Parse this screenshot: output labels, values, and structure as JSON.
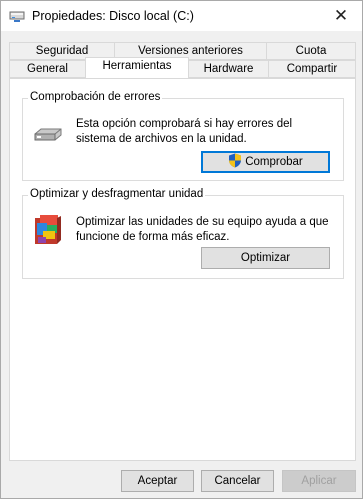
{
  "window": {
    "title": "Propiedades: Disco local (C:)",
    "close_glyph": "✕"
  },
  "tabs": {
    "row1": [
      "Seguridad",
      "Versiones anteriores",
      "Cuota"
    ],
    "row2": [
      "General",
      "Herramientas",
      "Hardware",
      "Compartir"
    ],
    "active": "Herramientas"
  },
  "error_check": {
    "title": "Comprobación de errores",
    "description_line1": "Esta opción comprobará si hay errores del",
    "description_line2": "sistema de archivos en la unidad.",
    "button_label": "Comprobar",
    "icon": "drive-icon",
    "button_icon": "uac-shield-icon"
  },
  "optimize": {
    "title": "Optimizar y desfragmentar unidad",
    "description_line1": "Optimizar las unidades de su equipo ayuda a que",
    "description_line2": "funcione de forma más eficaz.",
    "button_label": "Optimizar",
    "icon": "defrag-icon"
  },
  "footer": {
    "ok_label": "Aceptar",
    "cancel_label": "Cancelar",
    "apply_label": "Aplicar"
  },
  "colors": {
    "focus": "#0078d7",
    "shield_blue": "#1f5fbf",
    "shield_yellow": "#f2c21b"
  }
}
